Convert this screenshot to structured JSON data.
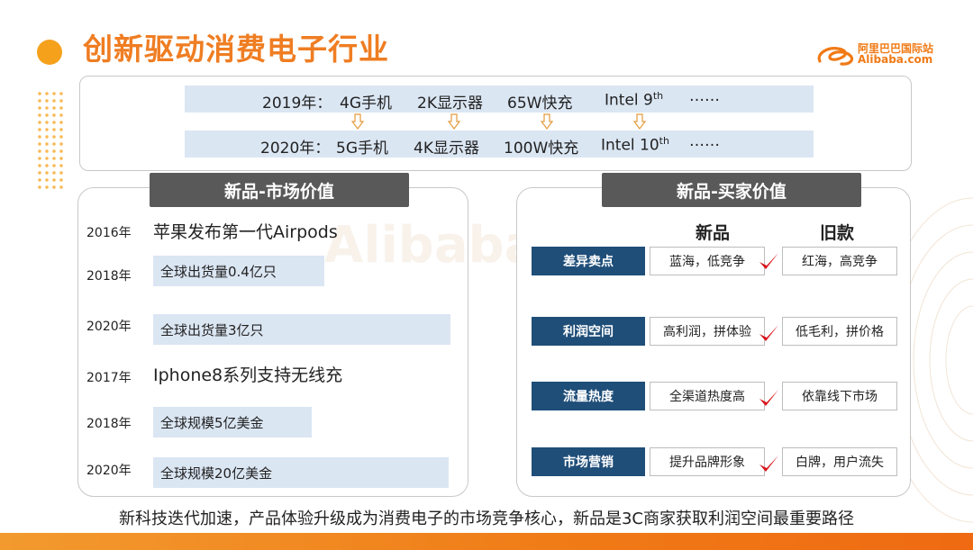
{
  "header": {
    "title": "创新驱动消费电子行业",
    "logo_cn": "阿里巴巴国际站",
    "logo_en": "Alibaba.com"
  },
  "timeline": {
    "row1": {
      "year": "2019年：",
      "items": [
        "4G手机",
        "2K显示器",
        "65W快充",
        "Intel 9",
        "……"
      ],
      "intel_sup": "th"
    },
    "row2": {
      "year": "2020年：",
      "items": [
        "5G手机",
        "4K显示器",
        "100W快充",
        "Intel 10",
        "……"
      ],
      "intel_sup": "th"
    }
  },
  "left_panel": {
    "header": "新品-市场价值",
    "entries": [
      {
        "year": "2016年",
        "text": "苹果发布第一代Airpods"
      },
      {
        "year": "2018年",
        "text": "全球出货量0.4亿只"
      },
      {
        "year": "2020年",
        "text": "全球出货量3亿只"
      },
      {
        "year": "2017年",
        "text": "Iphone8系列支持无线充"
      },
      {
        "year": "2018年",
        "text": "全球规模5亿美金"
      },
      {
        "year": "2020年",
        "text": "全球规模20亿美金"
      }
    ]
  },
  "right_panel": {
    "header": "新品-买家价值",
    "col_new": "新品",
    "col_old": "旧款",
    "rows": [
      {
        "category": "差异卖点",
        "new": "蓝海，低竞争",
        "old": "红海，高竞争"
      },
      {
        "category": "利润空间",
        "new": "高利润，拼体验",
        "old": "低毛利，拼价格"
      },
      {
        "category": "流量热度",
        "new": "全渠道热度高",
        "old": "依靠线下市场"
      },
      {
        "category": "市场营销",
        "new": "提升品牌形象",
        "old": "白牌，用户流失"
      }
    ]
  },
  "footer": {
    "text": "新科技迭代加速，产品体验升级成为消费电子的市场竞争核心，新品是3C商家获取利润空间最重要路径"
  },
  "colors": {
    "accent_orange": "#ef7d22",
    "header_gray": "#595959",
    "category_blue": "#1f4e79",
    "band_blue": "#dbe6f3",
    "check_red": "#d9141b"
  },
  "icons": [
    "down-arrow-icon",
    "check-icon",
    "alibaba-logo-icon"
  ]
}
